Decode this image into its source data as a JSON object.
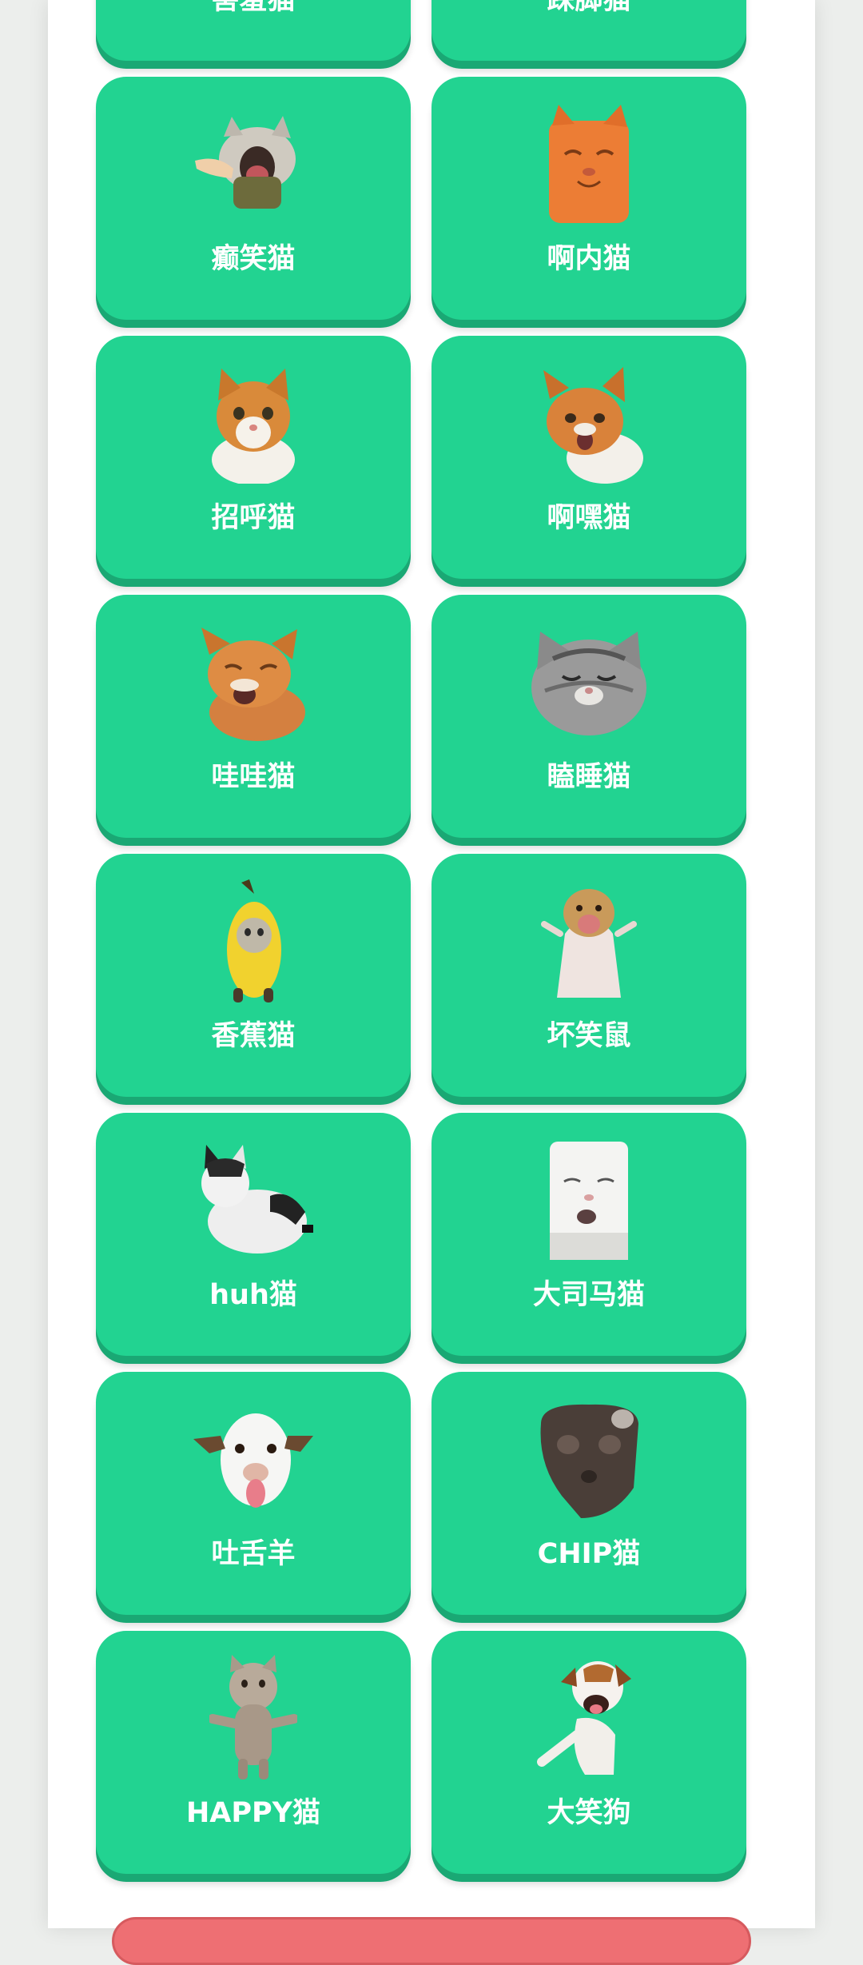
{
  "cards": [
    {
      "label": "害羞猫",
      "icon": "shy-cat-icon"
    },
    {
      "label": "跺脚猫",
      "icon": "stomping-cat-icon"
    },
    {
      "label": "癫笑猫",
      "icon": "crazy-laughing-cat-icon"
    },
    {
      "label": "啊内猫",
      "icon": "anei-cat-icon"
    },
    {
      "label": "招呼猫",
      "icon": "greeting-cat-icon"
    },
    {
      "label": "啊嘿猫",
      "icon": "ahei-cat-icon"
    },
    {
      "label": "哇哇猫",
      "icon": "wawa-cat-icon"
    },
    {
      "label": "瞌睡猫",
      "icon": "sleepy-cat-icon"
    },
    {
      "label": "香蕉猫",
      "icon": "banana-cat-icon"
    },
    {
      "label": "坏笑鼠",
      "icon": "smirking-rodent-icon"
    },
    {
      "label": "huh猫",
      "icon": "huh-cat-icon"
    },
    {
      "label": "大司马猫",
      "icon": "dasima-cat-icon"
    },
    {
      "label": "吐舌羊",
      "icon": "tongue-goat-icon"
    },
    {
      "label": "CHIP猫",
      "icon": "chip-cat-icon"
    },
    {
      "label": "HAPPY猫",
      "icon": "happy-cat-icon"
    },
    {
      "label": "大笑狗",
      "icon": "laughing-dog-icon"
    }
  ],
  "colors": {
    "card": "#22d391",
    "card_shadow": "#1aa874",
    "bottom_button": "#ee6f73"
  }
}
